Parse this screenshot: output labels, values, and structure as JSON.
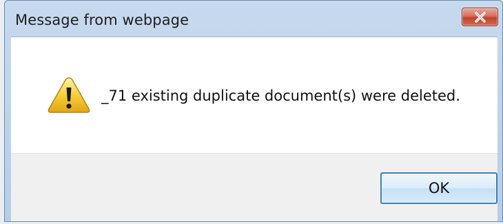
{
  "dialog": {
    "title": "Message from webpage",
    "message": "_71 existing duplicate document(s) were deleted.",
    "icon": "warning-icon",
    "ok_label": "OK",
    "close_icon": "close-icon"
  },
  "colors": {
    "title_bar": "#c7d9ee",
    "close_button": "#c1432b",
    "ok_border": "#3c7fb1",
    "warning_yellow": "#f5c82b"
  }
}
